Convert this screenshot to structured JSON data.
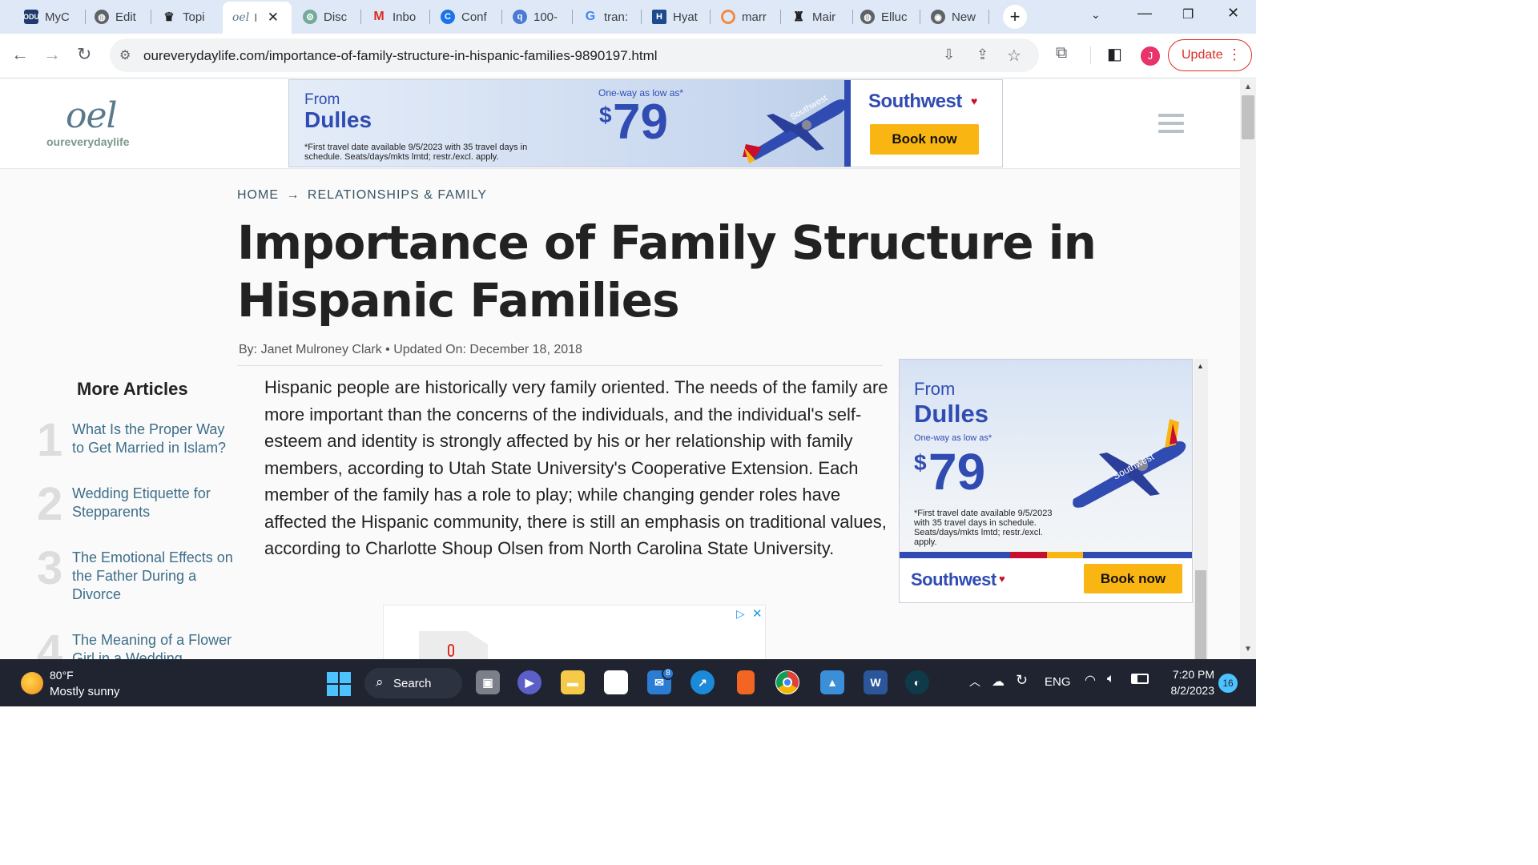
{
  "browser": {
    "tabs": [
      {
        "label": "MyC",
        "icon": "odu-icon"
      },
      {
        "label": "Edit",
        "icon": "globe-icon"
      },
      {
        "label": "Topi",
        "icon": "crown-icon"
      },
      {
        "label": "I",
        "icon": "oel-icon",
        "active": true
      },
      {
        "label": "Disc",
        "icon": "chatgpt-icon"
      },
      {
        "label": "Inbo",
        "icon": "gmail-icon"
      },
      {
        "label": "Conf",
        "icon": "circle-c-icon"
      },
      {
        "label": "100-",
        "icon": "quillbot-icon"
      },
      {
        "label": "tran:",
        "icon": "google-icon"
      },
      {
        "label": "Hyat",
        "icon": "h-icon"
      },
      {
        "label": "marr",
        "icon": "orange-ring-icon"
      },
      {
        "label": "Mair",
        "icon": "odu-crest-icon"
      },
      {
        "label": "Elluc",
        "icon": "globe-icon"
      },
      {
        "label": "New",
        "icon": "chrome-icon"
      }
    ],
    "active_tab_favicon": "oel",
    "url": "oureverydaylife.com/importance-of-family-structure-in-hispanic-families-9890197.html",
    "profile_initial": "J",
    "update_label": "Update"
  },
  "site": {
    "logo_mark": "oel",
    "logo_text": "oureverydaylife"
  },
  "top_ad": {
    "from": "From",
    "city": "Dulles",
    "one_way": "One-way as low as*",
    "dollar": "$",
    "price": "79",
    "disclaimer_1": "*First travel date available 9/5/2023 with 35 travel days in",
    "disclaimer_2": "schedule. Seats/days/mkts lmtd; restr./excl. apply.",
    "brand": "Southwest",
    "cta": "Book now",
    "plane_livery": "Southwest"
  },
  "article": {
    "breadcrumb_home": "HOME",
    "breadcrumb_arrow": "→",
    "breadcrumb_section": "RELATIONSHIPS & FAMILY",
    "title": "Importance of Family Structure in Hispanic Families",
    "byline": "By: Janet Mulroney Clark • Updated On: December 18, 2018",
    "body": "Hispanic people are historically very family oriented. The needs of the family are more important than the concerns of the individuals, and the individual's self-esteem and identity is strongly affected by his or her relationship with family members, according to Utah State University's Cooperative Extension. Each member of the family has a role to play; while changing gender roles have affected the Hispanic community, there is still an emphasis on traditional values, according to Charlotte Shoup Olsen from North Carolina State University."
  },
  "more_articles": {
    "heading": "More Articles",
    "items": [
      {
        "num": "1",
        "title": "What Is the Proper Way to Get Married in Islam?"
      },
      {
        "num": "2",
        "title": "Wedding Etiquette for Stepparents"
      },
      {
        "num": "3",
        "title": "The Emotional Effects on the Father During a Divorce"
      },
      {
        "num": "4",
        "title": "The Meaning of a Flower Girl in a Wedding"
      }
    ]
  },
  "side_ad": {
    "from": "From",
    "city": "Dulles",
    "one_way": "One-way as low as*",
    "dollar": "$",
    "price": "79",
    "disclaimer": "*First travel date available 9/5/2023 with 35 travel days in schedule. Seats/days/mkts lmtd; restr./excl. apply.",
    "brand": "Southwest",
    "cta": "Book now",
    "plane_livery": "Southwest"
  },
  "taskbar": {
    "weather_temp": "80°F",
    "weather_desc": "Mostly sunny",
    "search_label": "Search",
    "mail_badge": "8",
    "language": "ENG",
    "time": "7:20 PM",
    "date": "8/2/2023",
    "notification_count": "16"
  },
  "colors": {
    "southwest_blue": "#304cb2",
    "southwest_yellow": "#f9b612",
    "southwest_red": "#c8102e",
    "link_blue": "#3d6e8a",
    "update_red": "#d93025"
  }
}
